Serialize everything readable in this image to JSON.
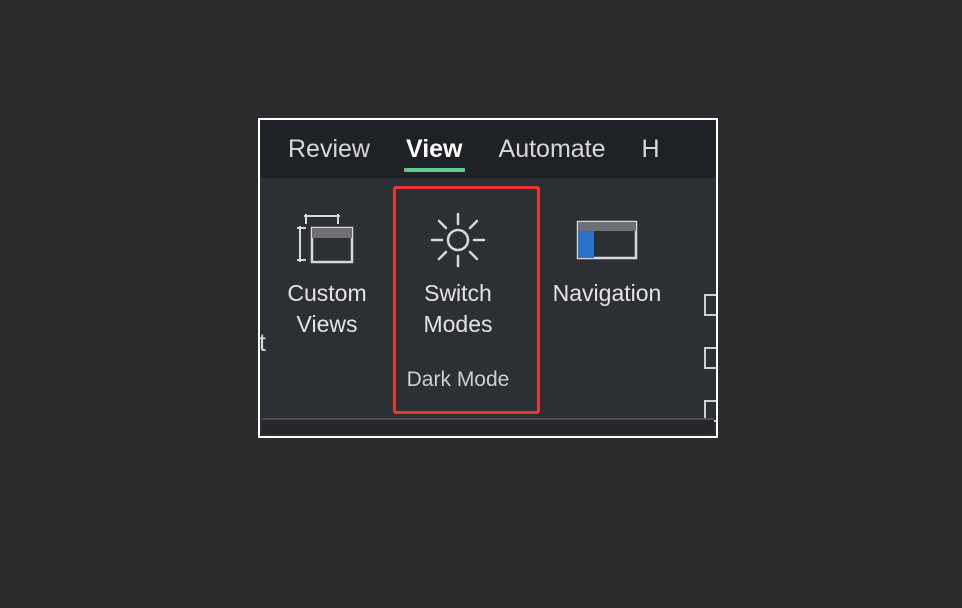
{
  "tabs": {
    "review": "Review",
    "view": "View",
    "automate": "Automate",
    "help_partial": "H"
  },
  "ribbon": {
    "custom_views": {
      "label": "Custom\nViews"
    },
    "switch_modes": {
      "label": "Switch\nModes",
      "caption": "Dark Mode"
    },
    "navigation": {
      "label": "Navigation"
    }
  },
  "partial_left_char": "t"
}
